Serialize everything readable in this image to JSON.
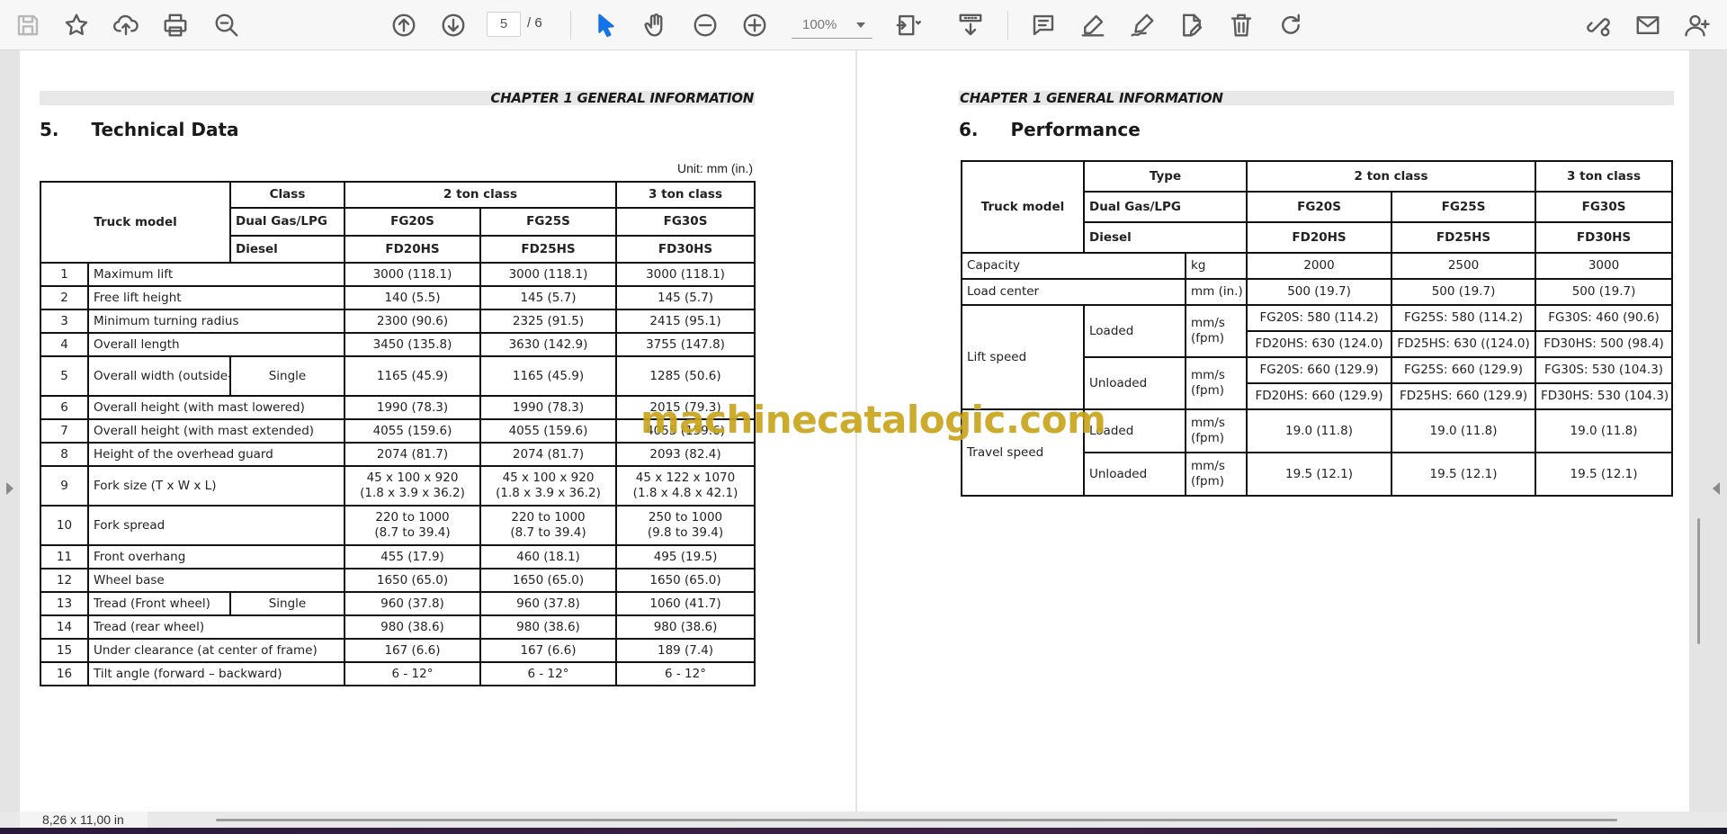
{
  "toolbar": {
    "page_current": "5",
    "page_total": "/ 6",
    "zoom": "100%"
  },
  "left_page": {
    "chapter": "CHAPTER 1 GENERAL INFORMATION",
    "section_number": "5.",
    "section_title": "Technical Data",
    "unit_note": "Unit: mm (in.)",
    "header": {
      "truck_model": "Truck model",
      "class": "Class",
      "ton2": "2 ton class",
      "ton3": "3 ton class",
      "dual": "Dual Gas/LPG",
      "diesel": "Diesel",
      "fg20s": "FG20S",
      "fg25s": "FG25S",
      "fg30s": "FG30S",
      "fd20hs": "FD20HS",
      "fd25hs": "FD25HS",
      "fd30hs": "FD30HS"
    },
    "rows": [
      {
        "n": "1",
        "label": "Maximum lift",
        "sub": "",
        "v1": "3000 (118.1)",
        "v2": "3000 (118.1)",
        "v3": "3000 (118.1)"
      },
      {
        "n": "2",
        "label": "Free lift height",
        "sub": "",
        "v1": "140 (5.5)",
        "v2": "145 (5.7)",
        "v3": "145 (5.7)"
      },
      {
        "n": "3",
        "label": "Minimum turning radius",
        "sub": "",
        "v1": "2300 (90.6)",
        "v2": "2325 (91.5)",
        "v3": "2415 (95.1)"
      },
      {
        "n": "4",
        "label": "Overall length",
        "sub": "",
        "v1": "3450 (135.8)",
        "v2": "3630 (142.9)",
        "v3": "3755 (147.8)"
      },
      {
        "n": "5",
        "label": "Overall width (outside-to- outside of tires)",
        "sub": "Single",
        "v1": "1165 (45.9)",
        "v2": "1165 (45.9)",
        "v3": "1285 (50.6)"
      },
      {
        "n": "6",
        "label": "Overall height (with mast lowered)",
        "sub": "",
        "v1": "1990 (78.3)",
        "v2": "1990 (78.3)",
        "v3": "2015 (79.3)"
      },
      {
        "n": "7",
        "label": "Overall height (with mast extended)",
        "sub": "",
        "v1": "4055 (159.6)",
        "v2": "4055 (159.6)",
        "v3": "4055 (159.6)"
      },
      {
        "n": "8",
        "label": "Height of the overhead guard",
        "sub": "",
        "v1": "2074 (81.7)",
        "v2": "2074 (81.7)",
        "v3": "2093 (82.4)"
      },
      {
        "n": "9",
        "label": "Fork size (T x W x L)",
        "sub": "",
        "v1": "45 x 100 x 920",
        "v1b": "(1.8 x 3.9 x 36.2)",
        "v2": "45 x 100 x 920",
        "v2b": "(1.8 x 3.9 x 36.2)",
        "v3": "45 x 122 x 1070",
        "v3b": "(1.8 x 4.8 x 42.1)"
      },
      {
        "n": "10",
        "label": "Fork spread",
        "sub": "",
        "v1": "220 to 1000",
        "v1b": "(8.7 to 39.4)",
        "v2": "220 to 1000",
        "v2b": "(8.7 to 39.4)",
        "v3": "250 to 1000",
        "v3b": "(9.8 to 39.4)"
      },
      {
        "n": "11",
        "label": "Front overhang",
        "sub": "",
        "v1": "455 (17.9)",
        "v2": "460 (18.1)",
        "v3": "495 (19.5)"
      },
      {
        "n": "12",
        "label": "Wheel base",
        "sub": "",
        "v1": "1650 (65.0)",
        "v2": "1650 (65.0)",
        "v3": "1650 (65.0)"
      },
      {
        "n": "13",
        "label": "Tread (Front wheel)",
        "sub": "Single",
        "v1": "960 (37.8)",
        "v2": "960 (37.8)",
        "v3": "1060 (41.7)"
      },
      {
        "n": "14",
        "label": "Tread (rear wheel)",
        "sub": "",
        "v1": "980 (38.6)",
        "v2": "980 (38.6)",
        "v3": "980 (38.6)"
      },
      {
        "n": "15",
        "label": "Under clearance (at center of frame)",
        "sub": "",
        "v1": "167 (6.6)",
        "v2": "167 (6.6)",
        "v3": "189 (7.4)"
      },
      {
        "n": "16",
        "label": "Tilt angle (forward – backward)",
        "sub": "",
        "v1": "6 - 12°",
        "v2": "6 - 12°",
        "v3": "6 - 12°"
      }
    ]
  },
  "right_page": {
    "chapter": "CHAPTER 1 GENERAL INFORMATION",
    "section_number": "6.",
    "section_title": "Performance",
    "header": {
      "truck_model": "Truck model",
      "type": "Type",
      "ton2": "2 ton class",
      "ton3": "3 ton class",
      "dual": "Dual Gas/LPG",
      "diesel": "Diesel",
      "fg20s": "FG20S",
      "fg25s": "FG25S",
      "fg30s": "FG30S",
      "fd20hs": "FD20HS",
      "fd25hs": "FD25HS",
      "fd30hs": "FD30HS"
    },
    "capacity": {
      "label": "Capacity",
      "unit": "kg",
      "v1": "2000",
      "v2": "2500",
      "v3": "3000"
    },
    "load_center": {
      "label": "Load center",
      "unit": "mm (in.)",
      "v1": "500 (19.7)",
      "v2": "500 (19.7)",
      "v3": "500 (19.7)"
    },
    "lift_speed": {
      "label": "Lift speed",
      "loaded": "Loaded",
      "unloaded": "Unloaded",
      "unit_a": "mm/s",
      "unit_b": "(fpm)",
      "loaded_fg": [
        "FG20S: 580 (114.2)",
        "FG25S: 580 (114.2)",
        "FG30S: 460 (90.6)"
      ],
      "loaded_fd": [
        "FD20HS: 630 (124.0)",
        "FD25HS: 630 ((124.0)",
        "FD30HS: 500 (98.4)"
      ],
      "unloaded_fg": [
        "FG20S: 660 (129.9)",
        "FG25S: 660 (129.9)",
        "FG30S: 530 (104.3)"
      ],
      "unloaded_fd": [
        "FD20HS: 660 (129.9)",
        "FD25HS: 660 (129.9)",
        "FD30HS: 530 (104.3)"
      ]
    },
    "travel_speed": {
      "label": "Travel speed",
      "loaded": "Loaded",
      "unloaded": "Unloaded",
      "unit_a": "mm/s",
      "unit_b": "(fpm)",
      "loaded_vals": [
        "19.0 (11.8)",
        "19.0 (11.8)",
        "19.0 (11.8)"
      ],
      "unloaded_vals": [
        "19.5 (12.1)",
        "19.5 (12.1)",
        "19.5 (12.1)"
      ]
    }
  },
  "watermark": "machinecatalogic.com",
  "status": {
    "page_size": "8,26 x 11,00 in"
  }
}
